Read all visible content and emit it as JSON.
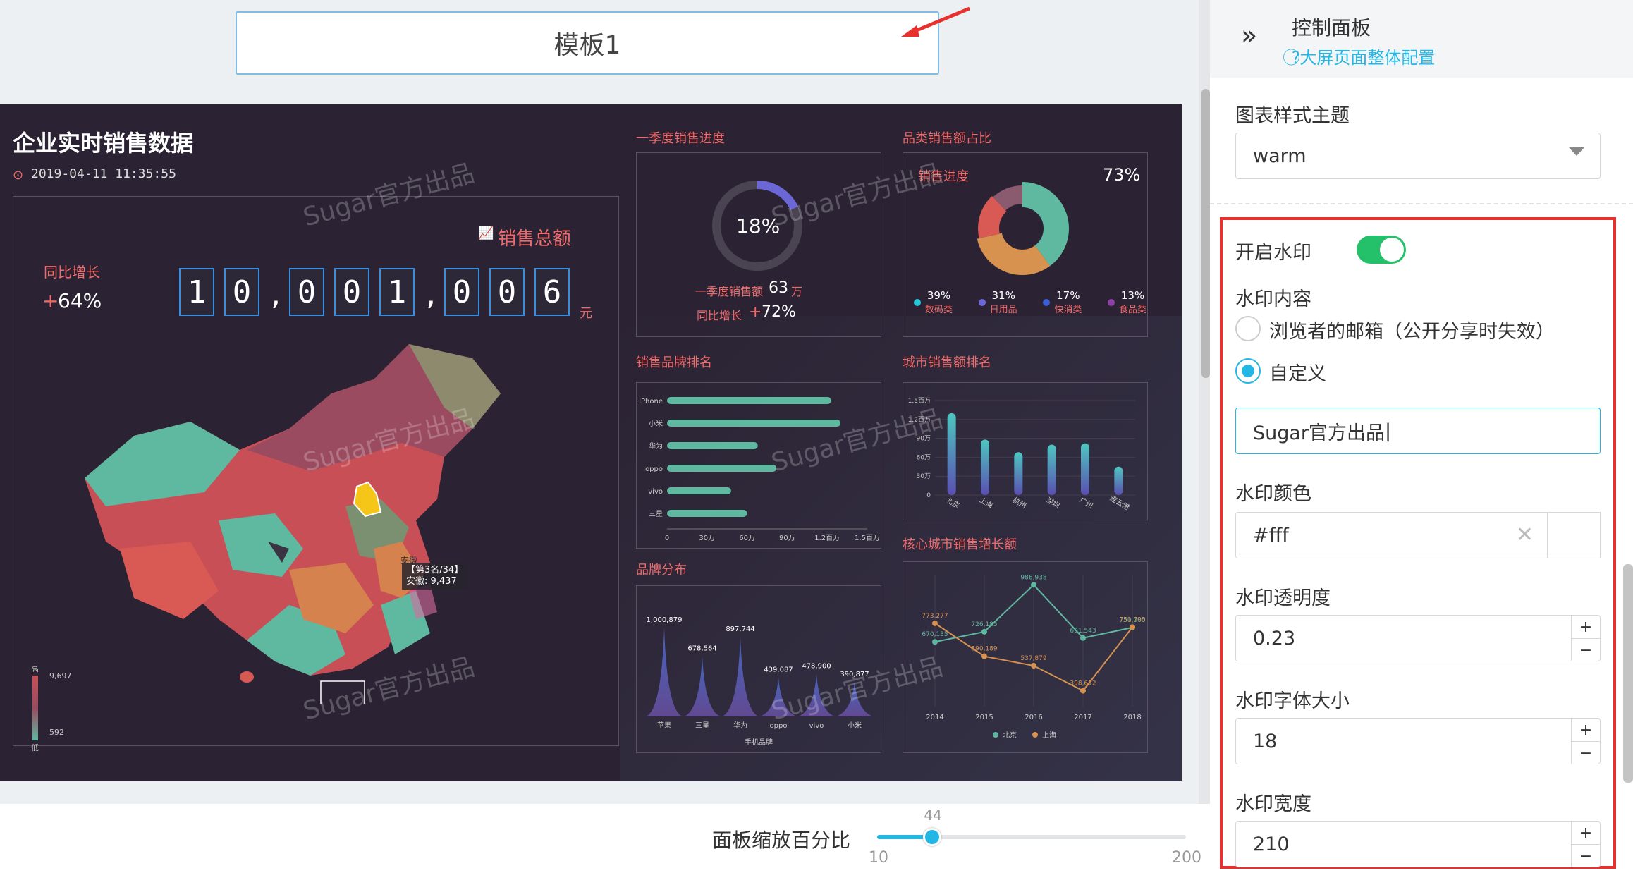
{
  "template": {
    "title": "模板1"
  },
  "dashboard": {
    "title": "企业实时销售数据",
    "datetime": "2019-04-11 11:35:55",
    "watermark": "Sugar官方出品",
    "sales_total_label": "销售总额",
    "yoy_label": "同比增长",
    "yoy_sign": "+",
    "yoy_value": "64%",
    "sales_digits": [
      "1",
      "0",
      ",",
      "0",
      "0",
      "1",
      ",",
      "0",
      "0",
      "6"
    ],
    "sales_unit": "元",
    "map_tooltip_line1": "【第3名/34】",
    "map_tooltip_line2": "安徽: 9,437",
    "map_province_label": "安徽",
    "legend_high": "高",
    "legend_low": "低",
    "legend_max": "9,697",
    "legend_min": "592",
    "q1": {
      "title": "一季度销售进度",
      "percent": "18%",
      "sales_label": "一季度销售额",
      "sales_value": "63",
      "sales_unit": "万",
      "yoy_label": "同比增长",
      "yoy_sign": "+",
      "yoy_value": "72%",
      "progress": 0.18
    },
    "category": {
      "title": "品类销售额占比",
      "subtitle": "销售进度",
      "percent": "73%",
      "items": [
        {
          "pct": "39%",
          "name": "数码类",
          "color": "#27c6d6"
        },
        {
          "pct": "31%",
          "name": "日用品",
          "color": "#6b67d6"
        },
        {
          "pct": "17%",
          "name": "快消类",
          "color": "#3a5fd6"
        },
        {
          "pct": "13%",
          "name": "食品类",
          "color": "#8f3fa6"
        }
      ]
    },
    "brand_rank": {
      "title": "销售品牌排名"
    },
    "city_rank": {
      "title": "城市销售额排名"
    },
    "brand_dist": {
      "title": "品牌分布",
      "legend": "手机品牌"
    },
    "core_city": {
      "title": "核心城市销售增长额",
      "legend_a": "北京",
      "legend_b": "上海"
    }
  },
  "chart_data": [
    {
      "type": "bar",
      "title": "销售品牌排名",
      "categories": [
        "iPhone",
        "小米",
        "华为",
        "oppo",
        "vivo",
        "三星"
      ],
      "values": [
        1230000,
        1300000,
        680000,
        820000,
        480000,
        600000
      ],
      "x_ticks": [
        "0",
        "30万",
        "60万",
        "90万",
        "1.2百万",
        "1.5百万"
      ],
      "xlim": [
        0,
        1500000
      ],
      "orientation": "horizontal",
      "color": "#5fb8a0"
    },
    {
      "type": "bar",
      "title": "城市销售额排名",
      "categories": [
        "北京",
        "上海",
        "杭州",
        "深圳",
        "广州",
        "连云港"
      ],
      "values": [
        1300000,
        880000,
        680000,
        800000,
        820000,
        450000
      ],
      "y_ticks": [
        "0",
        "30万",
        "60万",
        "90万",
        "1.2百万",
        "1.5百万"
      ],
      "ylim": [
        0,
        1500000
      ]
    },
    {
      "type": "area",
      "title": "品牌分布",
      "categories": [
        "苹果",
        "三星",
        "华为",
        "oppo",
        "vivo",
        "小米"
      ],
      "series": [
        {
          "name": "手机品牌",
          "values": [
            1000879,
            678564,
            897744,
            439087,
            478900,
            390877
          ]
        }
      ],
      "data_labels": [
        "1,000,879",
        "678,564",
        "897,744",
        "439,087",
        "478,900",
        "390,877"
      ]
    },
    {
      "type": "line",
      "title": "核心城市销售增长额",
      "x": [
        "2014",
        "2015",
        "2016",
        "2017",
        "2018"
      ],
      "series": [
        {
          "name": "北京",
          "values": [
            670135,
            726185,
            986938,
            691543,
            750000
          ],
          "labels": [
            "670,135",
            "726,185",
            "986,938",
            "691,543",
            "750,000"
          ],
          "color": "#5fb8a0"
        },
        {
          "name": "上海",
          "values": [
            773277,
            590189,
            537879,
            398612,
            751795
          ],
          "labels": [
            "773,277",
            "590,189",
            "537,879",
            "398,612",
            "751,795"
          ],
          "color": "#d6924e"
        }
      ]
    }
  ],
  "control_panel": {
    "title": "控制面板",
    "help_link": "大屏页面整体配置",
    "theme_label": "图表样式主题",
    "theme_value": "warm",
    "watermark_toggle_label": "开启水印",
    "watermark_enabled": true,
    "content_label": "水印内容",
    "option_email": "浏览者的邮箱（公开分享时失效）",
    "option_custom": "自定义",
    "selected_option": "自定义",
    "custom_text": "Sugar官方出品",
    "color_label": "水印颜色",
    "color_value": "#fff",
    "opacity_label": "水印透明度",
    "opacity_value": "0.23",
    "font_size_label": "水印字体大小",
    "font_size_value": "18",
    "width_label": "水印宽度",
    "width_value": "210"
  },
  "zoom": {
    "label": "面板缩放百分比",
    "value": "44",
    "min": "10",
    "max": "200",
    "fraction": 0.179
  },
  "colors": {
    "accent": "#23b7e5",
    "toggle": "#25c06a",
    "highlight_red": "#e8312f",
    "canvas_bg": "#2b2333"
  }
}
